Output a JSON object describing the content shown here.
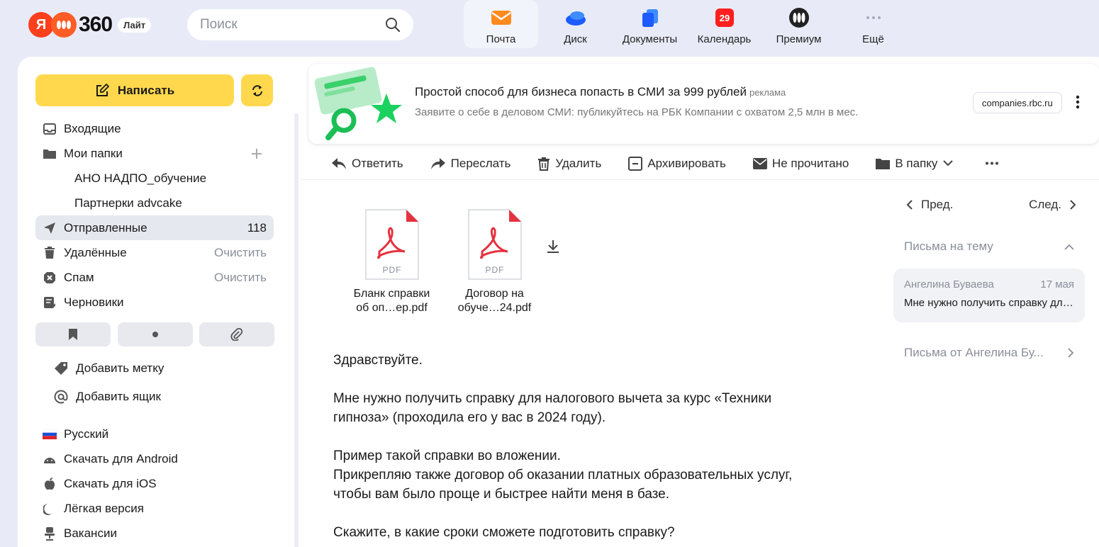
{
  "logo": {
    "letter": "Я",
    "number": "360",
    "badge": "Лайт"
  },
  "search": {
    "placeholder": "Поиск"
  },
  "services": [
    {
      "label": "Почта",
      "icon": "mail-icon"
    },
    {
      "label": "Диск",
      "icon": "disk-icon"
    },
    {
      "label": "Документы",
      "icon": "documents-icon"
    },
    {
      "label": "Календарь",
      "icon": "calendar-icon",
      "day": "29"
    },
    {
      "label": "Премиум",
      "icon": "premium-icon"
    },
    {
      "label": "Ещё",
      "icon": "more-icon"
    }
  ],
  "sidebar": {
    "compose_label": "Написать",
    "folders": [
      {
        "name": "Входящие"
      },
      {
        "name": "Мои папки"
      },
      {
        "name": "АНО НАДПО_обучение"
      },
      {
        "name": "Партнерки advcake"
      },
      {
        "name": "Отправленные",
        "count": "118"
      },
      {
        "name": "Удалённые",
        "action": "Очистить"
      },
      {
        "name": "Спам",
        "action": "Очистить"
      },
      {
        "name": "Черновики"
      }
    ],
    "extra": {
      "add_label": "Добавить метку",
      "add_box": "Добавить ящик"
    },
    "links": [
      "Русский",
      "Скачать для Android",
      "Скачать для iOS",
      "Лёгкая версия",
      "Вакансии"
    ]
  },
  "ad": {
    "title": "Простой способ для бизнеса попасть в СМИ за 999 рублей",
    "mark": "реклама",
    "description": "Заявите о себе в деловом СМИ: публикуйтесь на РБК Компании с охватом 2,5 млн в мес.",
    "domain": "companies.rbc.ru"
  },
  "toolbar": {
    "reply": "Ответить",
    "forward": "Переслать",
    "delete": "Удалить",
    "archive": "Архивировать",
    "unread": "Не прочитано",
    "to_folder": "В папку"
  },
  "attachments": [
    {
      "type": "PDF",
      "name_l1": "Бланк справки",
      "name_l2": "об оп…ер.pdf"
    },
    {
      "type": "PDF",
      "name_l1": "Договор на",
      "name_l2": "обуче…24.pdf"
    }
  ],
  "message": {
    "greeting": "Здравствуйте.",
    "p1_l1": "Мне нужно получить справку для налогового вычета за курс «Техники",
    "p1_l2": "гипноза» (проходила его у вас в 2024 году).",
    "p2_l1": "Пример такой справки во вложении.",
    "p2_l2": "Прикрепляю также договор об оказании платных образовательных услуг,",
    "p2_l3": "чтобы вам было проще и быстрее найти меня в базе.",
    "p3": "Скажите, в какие сроки сможете подготовить справку?"
  },
  "right_panel": {
    "prev": "Пред.",
    "next": "След.",
    "thread_header": "Письма на тему",
    "thread_item": {
      "sender": "Ангелина Буваева",
      "date": "17 мая",
      "subject": "Мне нужно получить справку для налогового вычета"
    },
    "from_link": "Письма от Ангелина Бу..."
  },
  "colors": {
    "accent": "#ffd84d",
    "background": "#e8ebf7",
    "pdf_red": "#e5323f"
  }
}
